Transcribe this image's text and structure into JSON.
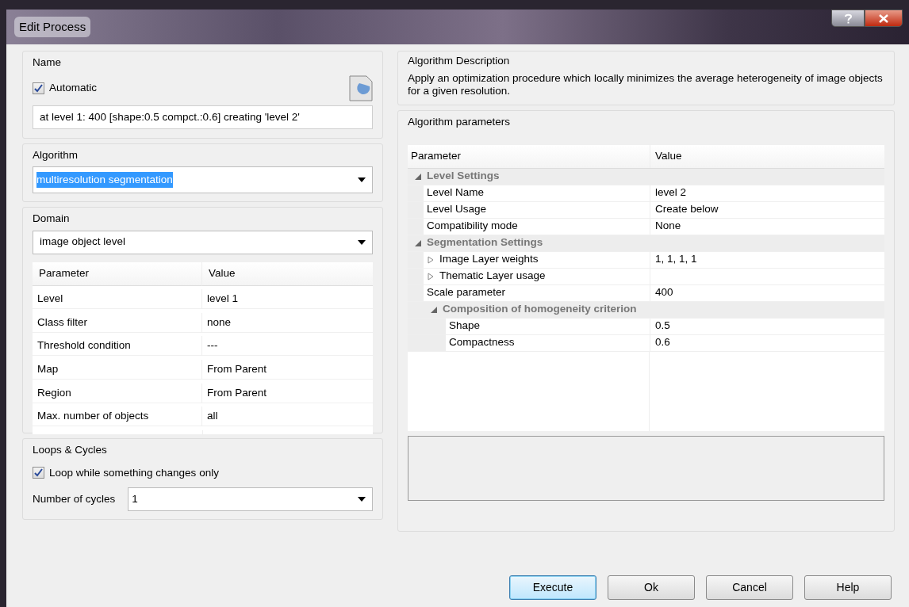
{
  "window": {
    "title": "Edit Process"
  },
  "name_group": {
    "title": "Name",
    "automatic": {
      "label": "Automatic",
      "checked": true
    },
    "value": "at  level 1: 400 [shape:0.5 compct.:0.6] creating 'level 2'"
  },
  "algorithm_group": {
    "title": "Algorithm",
    "value": "multiresolution segmentation",
    "text_selected": true
  },
  "domain_group": {
    "title": "Domain",
    "value": "image object level",
    "table": {
      "columns": [
        "Parameter",
        "Value"
      ],
      "rows": [
        {
          "parameter": "Level",
          "value": "level 1"
        },
        {
          "parameter": "Class filter",
          "value": "none"
        },
        {
          "parameter": "Threshold condition",
          "value": "---"
        },
        {
          "parameter": "Map",
          "value": "From Parent"
        },
        {
          "parameter": "Region",
          "value": "From Parent"
        },
        {
          "parameter": "Max. number of objects",
          "value": "all"
        }
      ]
    }
  },
  "loops_group": {
    "title": "Loops & Cycles",
    "loop": {
      "label": "Loop while something changes only",
      "checked": true
    },
    "cycles_label": "Number of cycles",
    "cycles_value": "1"
  },
  "description_group": {
    "title": "Algorithm Description",
    "text": "Apply an optimization procedure which locally minimizes the average heterogeneity of image objects for a given resolution."
  },
  "parameters_group": {
    "title": "Algorithm parameters",
    "columns": [
      "Parameter",
      "Value"
    ],
    "tree": [
      {
        "kind": "group",
        "label": "Level Settings",
        "expanded": true,
        "children": [
          {
            "kind": "param",
            "label": "Level Name",
            "value": "level 2"
          },
          {
            "kind": "param",
            "label": "Level Usage",
            "value": "Create below"
          },
          {
            "kind": "param",
            "label": "Compatibility mode",
            "value": "None"
          }
        ]
      },
      {
        "kind": "group",
        "label": "Segmentation Settings",
        "expanded": true,
        "children": [
          {
            "kind": "param",
            "label": "Image Layer weights",
            "value": "1, 1, 1, 1",
            "expanded": false
          },
          {
            "kind": "param",
            "label": "Thematic Layer usage",
            "expanded": false
          },
          {
            "kind": "param",
            "label": "Scale parameter",
            "value": "400"
          },
          {
            "kind": "group",
            "label": "Composition of homogeneity criterion",
            "expanded": true,
            "children": [
              {
                "kind": "param",
                "label": "Shape",
                "value": "0.5"
              },
              {
                "kind": "param",
                "label": "Compactness",
                "value": "0.6"
              }
            ]
          }
        ]
      }
    ]
  },
  "buttons": [
    {
      "label": "Execute",
      "default": true
    },
    {
      "label": "Ok",
      "default": false
    },
    {
      "label": "Cancel",
      "default": false
    },
    {
      "label": "Help",
      "default": false
    }
  ]
}
